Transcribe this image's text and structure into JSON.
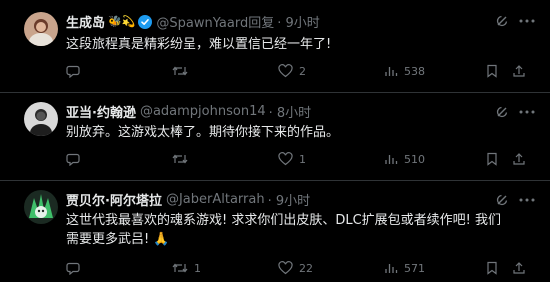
{
  "posts": [
    {
      "name": "生成岛",
      "emoji": "🐝💫",
      "verified": true,
      "handle": "@SpawnYaard回复",
      "time": "· 9小时",
      "text": "这段旅程真是精彩纷呈，难以置信已经一年了!",
      "replies": "",
      "reposts": "",
      "likes": "2",
      "views": "538"
    },
    {
      "name": "亚当·约翰逊",
      "emoji": "",
      "verified": false,
      "handle": "@adampjohnson14",
      "time": "· 8小时",
      "text": "别放弃。这游戏太棒了。期待你接下来的作品。",
      "replies": "",
      "reposts": "",
      "likes": "1",
      "views": "510"
    },
    {
      "name": "贾贝尔·阿尔塔拉",
      "emoji": "",
      "verified": false,
      "handle": "@JaberAltarrah",
      "time": "· 9小时",
      "text_line1": "这世代我最喜欢的魂系游戏! 求求你们出皮肤、DLC扩展包或者续作吧! 我们",
      "text_line2": "需要更多武吕! 🙏",
      "replies": "",
      "reposts": "1",
      "likes": "22",
      "views": "571"
    }
  ],
  "colors": {
    "background": "#000000",
    "text": "#e7e9ea",
    "muted": "#71767b",
    "verified": "#1d9bf0",
    "divider": "#2f3336"
  },
  "icons": [
    "grok-icon",
    "more-icon",
    "reply-icon",
    "repost-icon",
    "like-icon",
    "views-icon",
    "bookmark-icon",
    "share-icon"
  ]
}
